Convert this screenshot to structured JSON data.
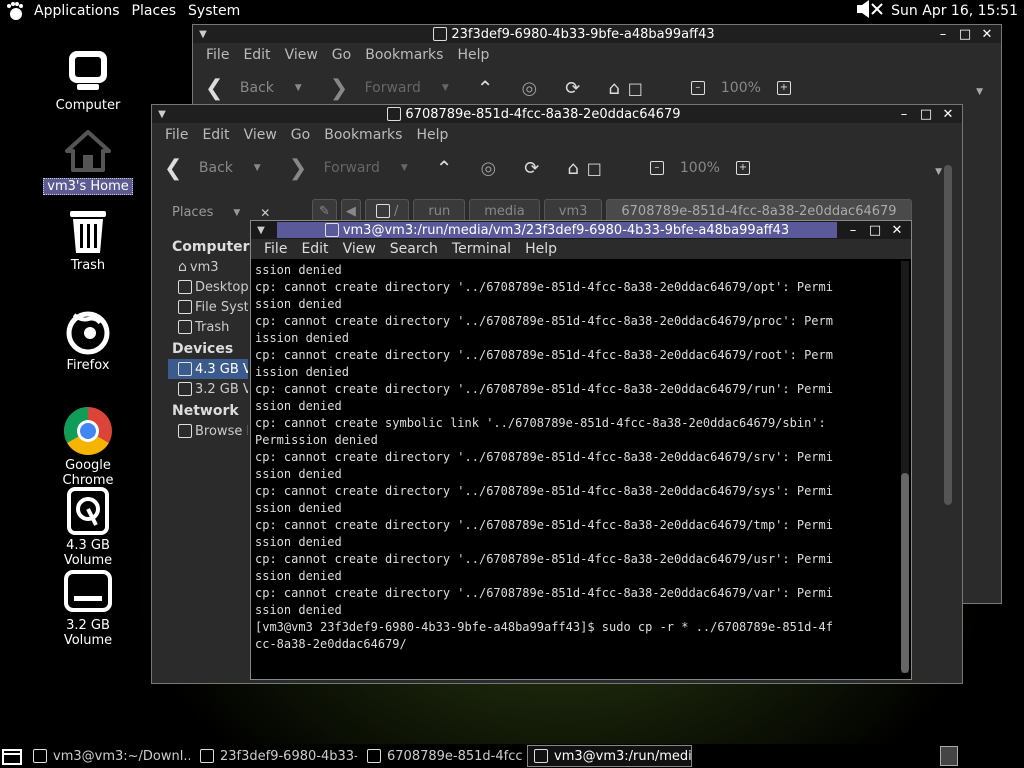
{
  "top_panel": {
    "menus": [
      "Applications",
      "Places",
      "System"
    ],
    "clock": "Sun Apr 16, 15:51",
    "volume_icon": "speaker-muted-icon"
  },
  "desktop_icons": [
    {
      "label": "Computer",
      "icon": "monitor-icon"
    },
    {
      "label": "vm3's Home",
      "icon": "home-icon",
      "selected": true
    },
    {
      "label": "Trash",
      "icon": "trash-icon"
    },
    {
      "label": "Firefox",
      "icon": "firefox-icon"
    },
    {
      "label": "Google Chrome",
      "icon": "chrome-icon"
    },
    {
      "label": "4.3 GB Volume",
      "icon": "drive-icon"
    },
    {
      "label": "3.2 GB Volume",
      "icon": "drive-icon"
    }
  ],
  "fm_back": {
    "title": "23f3def9-6980-4b33-9bfe-a48ba99aff43",
    "menus": [
      "File",
      "Edit",
      "View",
      "Go",
      "Bookmarks",
      "Help"
    ],
    "toolbar": {
      "back": "Back",
      "forward": "Forward",
      "zoom": "100%"
    }
  },
  "fm_front": {
    "title": "6708789e-851d-4fcc-8a38-2e0ddac64679",
    "menus": [
      "File",
      "Edit",
      "View",
      "Go",
      "Bookmarks",
      "Help"
    ],
    "toolbar": {
      "back": "Back",
      "forward": "Forward",
      "zoom": "100%"
    },
    "places_label": "Places",
    "path": [
      "run",
      "media",
      "vm3",
      "6708789e-851d-4fcc-8a38-2e0ddac64679"
    ],
    "sidebar": {
      "computer_heading": "Computer",
      "computer_items": [
        "vm3",
        "Desktop",
        "File System",
        "Trash"
      ],
      "devices_heading": "Devices",
      "device_items": [
        "4.3 GB Volume",
        "3.2 GB Volume"
      ],
      "network_heading": "Network",
      "network_items": [
        "Browse Network"
      ]
    }
  },
  "terminal": {
    "title": "vm3@vm3:/run/media/vm3/23f3def9-6980-4b33-9bfe-a48ba99aff43",
    "menus": [
      "File",
      "Edit",
      "View",
      "Search",
      "Terminal",
      "Help"
    ],
    "lines": [
      "ssion denied",
      "cp: cannot create directory '../6708789e-851d-4fcc-8a38-2e0ddac64679/opt': Permi",
      "ssion denied",
      "cp: cannot create directory '../6708789e-851d-4fcc-8a38-2e0ddac64679/proc': Perm",
      "ission denied",
      "cp: cannot create directory '../6708789e-851d-4fcc-8a38-2e0ddac64679/root': Perm",
      "ission denied",
      "cp: cannot create directory '../6708789e-851d-4fcc-8a38-2e0ddac64679/run': Permi",
      "ssion denied",
      "cp: cannot create symbolic link '../6708789e-851d-4fcc-8a38-2e0ddac64679/sbin':",
      "Permission denied",
      "cp: cannot create directory '../6708789e-851d-4fcc-8a38-2e0ddac64679/srv': Permi",
      "ssion denied",
      "cp: cannot create directory '../6708789e-851d-4fcc-8a38-2e0ddac64679/sys': Permi",
      "ssion denied",
      "cp: cannot create directory '../6708789e-851d-4fcc-8a38-2e0ddac64679/tmp': Permi",
      "ssion denied",
      "cp: cannot create directory '../6708789e-851d-4fcc-8a38-2e0ddac64679/usr': Permi",
      "ssion denied",
      "cp: cannot create directory '../6708789e-851d-4fcc-8a38-2e0ddac64679/var': Permi",
      "ssion denied",
      "[vm3@vm3 23f3def9-6980-4b33-9bfe-a48ba99aff43]$ sudo cp -r * ../6708789e-851d-4f",
      "cc-8a38-2e0ddac64679/"
    ]
  },
  "taskbar": [
    {
      "label": "vm3@vm3:~/Downl...",
      "active": false
    },
    {
      "label": "23f3def9-6980-4b33-...",
      "active": false
    },
    {
      "label": "6708789e-851d-4fcc...",
      "active": false
    },
    {
      "label": "vm3@vm3:/run/medi...",
      "active": true
    }
  ]
}
